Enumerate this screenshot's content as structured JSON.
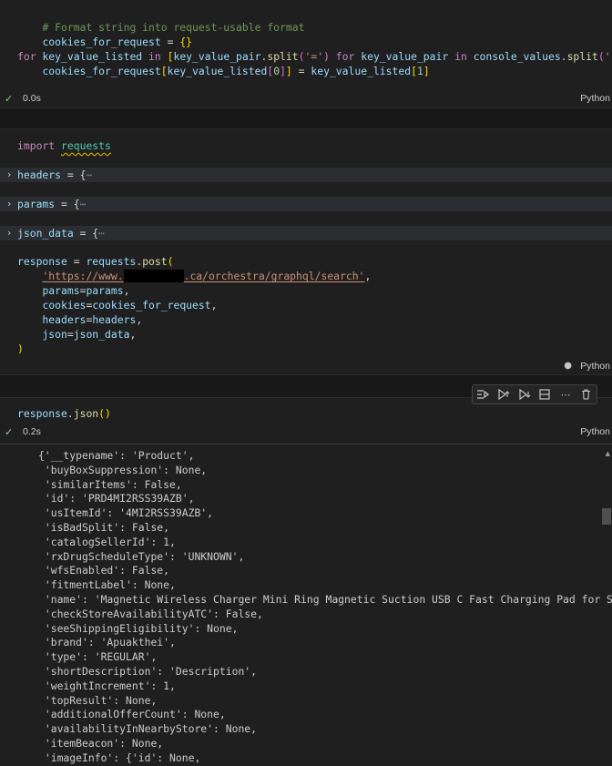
{
  "cell1": {
    "comment": "# Format string into request-usable format",
    "line2_var": "cookies_for_request",
    "line2_rest": " = ",
    "line2_braces": "{}",
    "for_kw": "for",
    "for_var": "key_value_listed",
    "in_kw": "in",
    "list_open": "[",
    "kvp": "key_value_pair",
    "split_fn": "split",
    "paren_open": "(",
    "eq_str": "'='",
    "paren_close": ")",
    "for_kw2": "for",
    "kvp2": "key_value_pair",
    "in_kw2": "in",
    "console_values": "console_values",
    "split_fn2": "split",
    "semi_str": "';'",
    "list_close": "]",
    "colon": ":",
    "assign_target": "cookies_for_request",
    "idx0": "key_value_listed",
    "zero": "0",
    "idx1": "key_value_listed",
    "one": "1",
    "status_time": "0.0s",
    "status_lang": "Python"
  },
  "cell2": {
    "import_kw": "import",
    "module": "requests",
    "headers_var": "headers",
    "params_var": "params",
    "json_var": "json_data",
    "fold_suffix": "= {",
    "ellipsis": "⋯",
    "response_var": "response",
    "requests_mod": "requests",
    "post_fn": "post",
    "url_start": "'https://www.",
    "url_end": ".ca/orchestra/graphql/search'",
    "arg_params": "params",
    "arg_params_val": "params",
    "arg_cookies": "cookies",
    "arg_cookies_val": "cookies_for_request",
    "arg_headers": "headers",
    "arg_headers_val": "headers",
    "arg_json": "json",
    "arg_json_val": "json_data",
    "close_paren": ")",
    "status_lang": "Python"
  },
  "cell3": {
    "code_var": "response",
    "code_fn": "json",
    "code_parens": "()",
    "status_time": "0.2s",
    "status_lang": "Python"
  },
  "toolbar": {
    "icons": [
      "run-by-line-icon",
      "execute-above-icon",
      "execute-below-icon",
      "split-cell-icon",
      "more-icon",
      "delete-icon"
    ]
  },
  "output": {
    "lines": [
      "{'__typename': 'Product',",
      " 'buyBoxSuppression': None,",
      " 'similarItems': False,",
      " 'id': 'PRD4MI2RSS39AZB',",
      " 'usItemId': '4MI2RSS39AZB',",
      " 'isBadSplit': False,",
      " 'catalogSellerId': 1,",
      " 'rxDrugScheduleType': 'UNKNOWN',",
      " 'wfsEnabled': False,",
      " 'fitmentLabel': None,",
      " 'name': 'Magnetic Wireless Charger Mini Ring Magnetic Suction USB C Fast Charging Pad for Smart",
      " 'checkStoreAvailabilityATC': False,",
      " 'seeShippingEligibility': None,",
      " 'brand': 'Apuakthei',",
      " 'type': 'REGULAR',",
      " 'shortDescription': 'Description',",
      " 'weightIncrement': 1,",
      " 'topResult': None,",
      " 'additionalOfferCount': None,",
      " 'availabilityInNearbyStore': None,",
      " 'itemBeacon': None,",
      " 'imageInfo': {'id': None,"
    ]
  }
}
